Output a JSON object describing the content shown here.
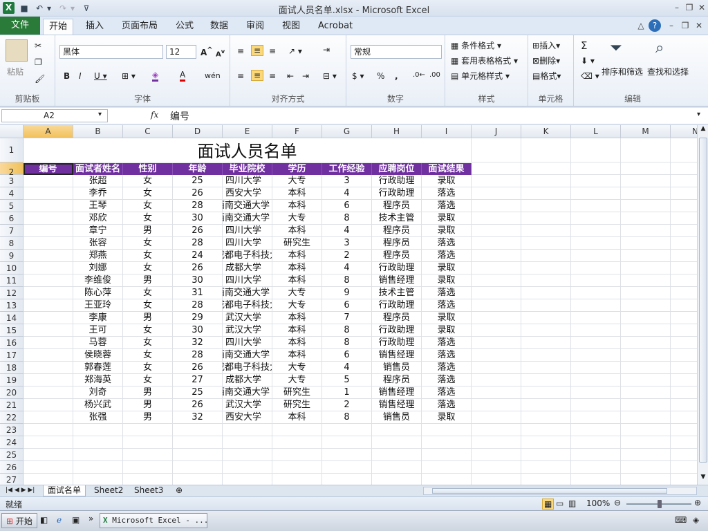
{
  "window": {
    "title": "面试人员名单.xlsx - Microsoft Excel"
  },
  "tabs": [
    "文件",
    "开始",
    "插入",
    "页面布局",
    "公式",
    "数据",
    "审阅",
    "视图",
    "Acrobat"
  ],
  "active_tab": "开始",
  "ribbon": {
    "clipboard": {
      "paste": "粘贴",
      "label": "剪贴板"
    },
    "font": {
      "name": "黑体",
      "size": "12",
      "label": "字体"
    },
    "alignment": {
      "label": "对齐方式"
    },
    "number": {
      "format": "常规",
      "label": "数字",
      "percent": "%",
      "comma": ","
    },
    "styles": {
      "conditional": "条件格式",
      "table": "套用表格格式",
      "cell": "单元格样式",
      "label": "样式"
    },
    "cells": {
      "insert": "插入",
      "delete": "删除",
      "format": "格式",
      "label": "单元格"
    },
    "editing": {
      "sum": "Σ",
      "sort": "排序和筛选",
      "find": "查找和选择",
      "label": "编辑"
    }
  },
  "formula_bar": {
    "name_box": "A2",
    "fx": "fx",
    "content": "编号"
  },
  "sheet": {
    "columns": [
      "A",
      "B",
      "C",
      "D",
      "E",
      "F",
      "G",
      "H",
      "I",
      "J",
      "K",
      "L",
      "M",
      "N"
    ],
    "row_numbers": [
      "1",
      "2",
      "3",
      "4",
      "5",
      "6",
      "7",
      "8",
      "9",
      "10",
      "11",
      "12",
      "13",
      "14",
      "15",
      "16",
      "17",
      "18",
      "19",
      "20",
      "21",
      "22",
      "23",
      "24",
      "25",
      "26",
      "27"
    ],
    "title": "面试人员名单",
    "headers": [
      "编号",
      "面试者姓名",
      "性别",
      "年龄",
      "毕业院校",
      "学历",
      "工作经验",
      "应聘岗位",
      "面试结果"
    ],
    "rows": [
      [
        "",
        "张超",
        "女",
        "25",
        "四川大学",
        "大专",
        "3",
        "行政助理",
        "录取"
      ],
      [
        "",
        "李乔",
        "女",
        "26",
        "西安大学",
        "本科",
        "4",
        "行政助理",
        "落选"
      ],
      [
        "",
        "王琴",
        "女",
        "28",
        "西南交通大学",
        "本科",
        "6",
        "程序员",
        "落选"
      ],
      [
        "",
        "邓欣",
        "女",
        "30",
        "西南交通大学",
        "大专",
        "8",
        "技术主管",
        "录取"
      ],
      [
        "",
        "章宁",
        "男",
        "26",
        "四川大学",
        "本科",
        "4",
        "程序员",
        "录取"
      ],
      [
        "",
        "张容",
        "女",
        "28",
        "四川大学",
        "研究生",
        "3",
        "程序员",
        "落选"
      ],
      [
        "",
        "郑燕",
        "女",
        "24",
        "成都电子科技大学",
        "本科",
        "2",
        "程序员",
        "落选"
      ],
      [
        "",
        "刘娜",
        "女",
        "26",
        "成都大学",
        "本科",
        "4",
        "行政助理",
        "录取"
      ],
      [
        "",
        "李维俊",
        "男",
        "30",
        "四川大学",
        "本科",
        "8",
        "销售经理",
        "录取"
      ],
      [
        "",
        "陈心萍",
        "女",
        "31",
        "西南交通大学",
        "大专",
        "9",
        "技术主管",
        "落选"
      ],
      [
        "",
        "王亚玲",
        "女",
        "28",
        "成都电子科技大学",
        "大专",
        "6",
        "行政助理",
        "落选"
      ],
      [
        "",
        "李康",
        "男",
        "29",
        "武汉大学",
        "本科",
        "7",
        "程序员",
        "录取"
      ],
      [
        "",
        "王可",
        "女",
        "30",
        "武汉大学",
        "本科",
        "8",
        "行政助理",
        "录取"
      ],
      [
        "",
        "马蓉",
        "女",
        "32",
        "四川大学",
        "本科",
        "8",
        "行政助理",
        "落选"
      ],
      [
        "",
        "侯晓蓉",
        "女",
        "28",
        "西南交通大学",
        "本科",
        "6",
        "销售经理",
        "落选"
      ],
      [
        "",
        "郭春莲",
        "女",
        "26",
        "成都电子科技大学",
        "大专",
        "4",
        "销售员",
        "落选"
      ],
      [
        "",
        "郑海英",
        "女",
        "27",
        "成都大学",
        "大专",
        "5",
        "程序员",
        "落选"
      ],
      [
        "",
        "刘奇",
        "男",
        "25",
        "西南交通大学",
        "研究生",
        "1",
        "销售经理",
        "落选"
      ],
      [
        "",
        "杨兴武",
        "男",
        "26",
        "武汉大学",
        "研究生",
        "2",
        "销售经理",
        "落选"
      ],
      [
        "",
        "张强",
        "男",
        "32",
        "西安大学",
        "本科",
        "8",
        "销售员",
        "录取"
      ]
    ]
  },
  "sheet_tabs": [
    "面试名单",
    "Sheet2",
    "Sheet3"
  ],
  "status": {
    "ready": "就绪",
    "zoom": "100%"
  },
  "taskbar": {
    "start": "开始",
    "task": "Microsoft Excel - ..."
  }
}
